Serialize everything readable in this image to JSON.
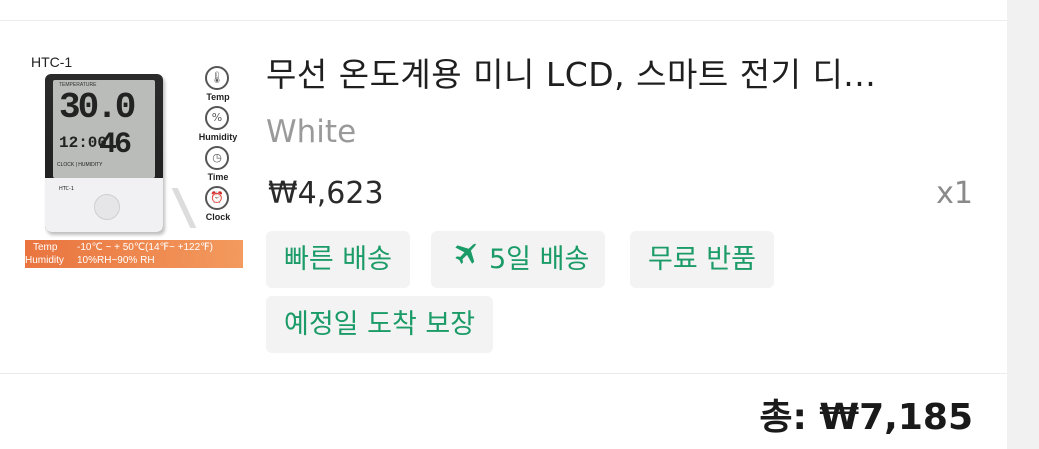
{
  "product": {
    "image": {
      "model": "HTC-1",
      "screen_header": "TEMPERATURE",
      "screen_temp": "30.0",
      "screen_time": "12:00",
      "screen_humidity": "46",
      "screen_mode": "CLOCK | HUMIDITY",
      "device_label": "HTC-1",
      "features": [
        {
          "label": "Temp",
          "icon": "thermometer-icon",
          "glyph": "🌡"
        },
        {
          "label": "Humidity",
          "icon": "water-drop-icon",
          "glyph": "%"
        },
        {
          "label": "Time",
          "icon": "clock-icon",
          "glyph": "◷"
        },
        {
          "label": "Clock",
          "icon": "alarm-clock-icon",
          "glyph": "⏰"
        }
      ],
      "spec_temp_label": "Temp",
      "spec_temp_value": "-10℃ ~ + 50℃(14℉~ +122℉)",
      "spec_humidity_label": "Humidity",
      "spec_humidity_value": "10%RH~90% RH"
    },
    "title": "무선 온도계용 미니 LCD, 스마트 전기 디...",
    "option": "White",
    "price": "₩4,623",
    "quantity": "x1",
    "tags": [
      {
        "label": "빠른 배송",
        "icon": null
      },
      {
        "label": "5일 배송",
        "icon": "airplane-icon"
      },
      {
        "label": "무료 반품",
        "icon": null
      },
      {
        "label": "예정일 도착 보장",
        "icon": null
      }
    ]
  },
  "total": {
    "label": "총: ₩7,185"
  },
  "colors": {
    "tag_text": "#1a9b67",
    "tag_bg": "#f3f3f3",
    "spec_band": "#e9743f"
  }
}
